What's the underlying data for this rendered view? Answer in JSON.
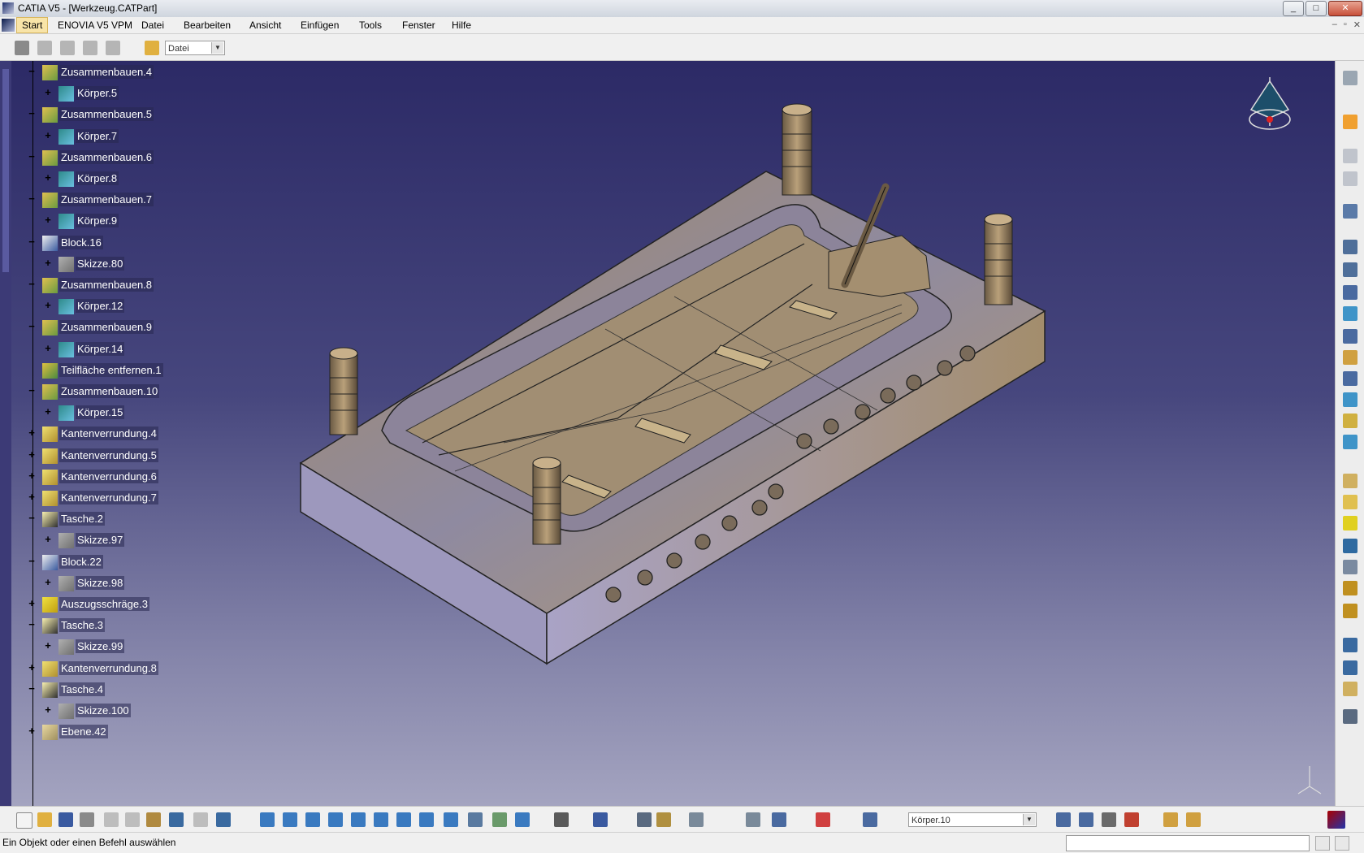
{
  "window": {
    "title": "CATIA V5 - [Werkzeug.CATPart]",
    "buttons": [
      "_",
      "□",
      "✕"
    ]
  },
  "menubar": {
    "items": [
      "Start",
      "ENOVIA V5 VPM",
      "Datei",
      "Bearbeiten",
      "Ansicht",
      "Einfügen",
      "Tools",
      "Fenster",
      "Hilfe"
    ],
    "active": "Start",
    "mdi_buttons": [
      "–",
      "▫",
      "✕"
    ]
  },
  "toolbar_top": {
    "combo_value": "Datei"
  },
  "tree": {
    "nodes": [
      {
        "label": "Zusammenbauen.4",
        "level": 0,
        "icon": "assemble-icon",
        "expander": "minus"
      },
      {
        "label": "Körper.5",
        "level": 1,
        "icon": "body-icon",
        "expander": "plus"
      },
      {
        "label": "Zusammenbauen.5",
        "level": 0,
        "icon": "assemble-icon",
        "expander": "minus"
      },
      {
        "label": "Körper.7",
        "level": 1,
        "icon": "body-icon",
        "expander": "plus"
      },
      {
        "label": "Zusammenbauen.6",
        "level": 0,
        "icon": "assemble-icon",
        "expander": "minus"
      },
      {
        "label": "Körper.8",
        "level": 1,
        "icon": "body-icon",
        "expander": "plus"
      },
      {
        "label": "Zusammenbauen.7",
        "level": 0,
        "icon": "assemble-icon",
        "expander": "minus"
      },
      {
        "label": "Körper.9",
        "level": 1,
        "icon": "body-icon",
        "expander": "plus"
      },
      {
        "label": "Block.16",
        "level": 0,
        "icon": "pad-icon",
        "expander": "minus"
      },
      {
        "label": "Skizze.80",
        "level": 1,
        "icon": "sketch-icon",
        "expander": "plus"
      },
      {
        "label": "Zusammenbauen.8",
        "level": 0,
        "icon": "assemble-icon",
        "expander": "minus"
      },
      {
        "label": "Körper.12",
        "level": 1,
        "icon": "body-icon",
        "expander": "plus"
      },
      {
        "label": "Zusammenbauen.9",
        "level": 0,
        "icon": "assemble-icon",
        "expander": "minus"
      },
      {
        "label": "Körper.14",
        "level": 1,
        "icon": "body-icon",
        "expander": "plus"
      },
      {
        "label": "Teilfläche entfernen.1",
        "level": 0,
        "icon": "remove-face-icon",
        "expander": "none"
      },
      {
        "label": "Zusammenbauen.10",
        "level": 0,
        "icon": "assemble-icon",
        "expander": "minus"
      },
      {
        "label": "Körper.15",
        "level": 1,
        "icon": "body-icon",
        "expander": "plus"
      },
      {
        "label": "Kantenverrundung.4",
        "level": 0,
        "icon": "fillet-icon",
        "expander": "plus"
      },
      {
        "label": "Kantenverrundung.5",
        "level": 0,
        "icon": "fillet-icon",
        "expander": "plus"
      },
      {
        "label": "Kantenverrundung.6",
        "level": 0,
        "icon": "fillet-icon",
        "expander": "plus"
      },
      {
        "label": "Kantenverrundung.7",
        "level": 0,
        "icon": "fillet-icon",
        "expander": "plus"
      },
      {
        "label": "Tasche.2",
        "level": 0,
        "icon": "pocket-icon",
        "expander": "minus"
      },
      {
        "label": "Skizze.97",
        "level": 1,
        "icon": "sketch-icon",
        "expander": "plus"
      },
      {
        "label": "Block.22",
        "level": 0,
        "icon": "pad-icon",
        "expander": "minus"
      },
      {
        "label": "Skizze.98",
        "level": 1,
        "icon": "sketch-icon",
        "expander": "plus"
      },
      {
        "label": "Auszugsschräge.3",
        "level": 0,
        "icon": "draft-icon",
        "expander": "plus"
      },
      {
        "label": "Tasche.3",
        "level": 0,
        "icon": "pocket-icon",
        "expander": "minus"
      },
      {
        "label": "Skizze.99",
        "level": 1,
        "icon": "sketch-icon",
        "expander": "plus"
      },
      {
        "label": "Kantenverrundung.8",
        "level": 0,
        "icon": "fillet-icon",
        "expander": "plus"
      },
      {
        "label": "Tasche.4",
        "level": 0,
        "icon": "pocket-icon",
        "expander": "minus"
      },
      {
        "label": "Skizze.100",
        "level": 1,
        "icon": "sketch-icon",
        "expander": "plus"
      },
      {
        "label": "Ebene.42",
        "level": 0,
        "icon": "plane-icon",
        "expander": "plus"
      }
    ]
  },
  "bottom_toolbar": {
    "current_body": "Körper.10"
  },
  "statusbar": {
    "message": "Ein Objekt oder einen Befehl auswählen"
  },
  "colors": {
    "viewport_top": "#2c2a66",
    "viewport_bottom": "#a4a4c0",
    "part_tan": "#b59a6a",
    "part_grey": "#9b97a8"
  }
}
